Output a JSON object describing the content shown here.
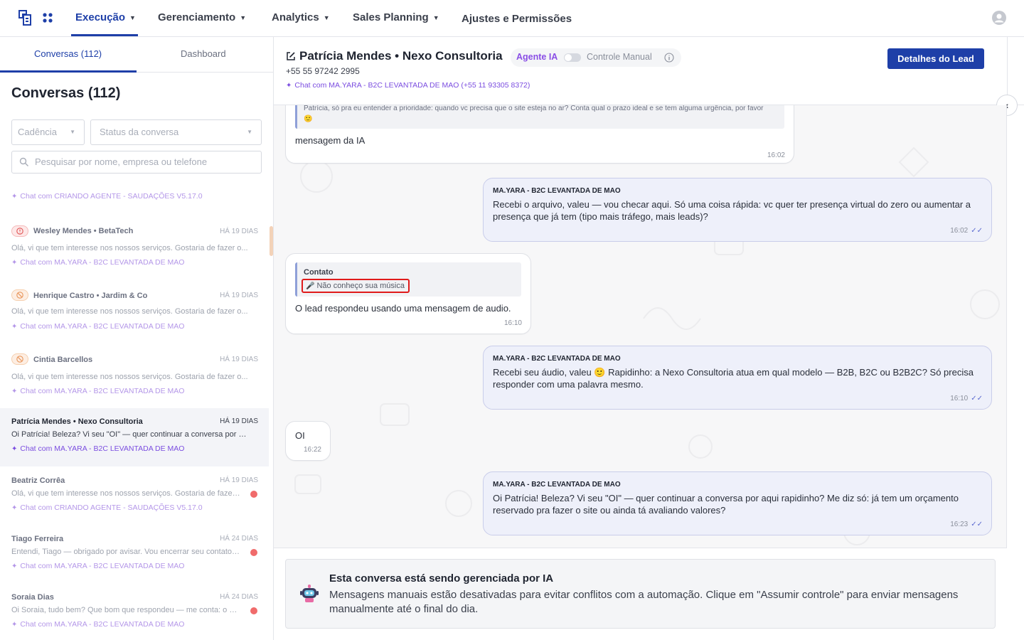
{
  "nav": {
    "items": [
      {
        "label": "Execução",
        "caret": true,
        "active": true
      },
      {
        "label": "Gerenciamento",
        "caret": true
      },
      {
        "label": "Analytics",
        "caret": true
      },
      {
        "label": "Sales Planning",
        "caret": true
      },
      {
        "label": "Ajustes e Permissões",
        "caret": false
      }
    ]
  },
  "sidebar": {
    "tabs": [
      {
        "label": "Conversas (112)",
        "active": true
      },
      {
        "label": "Dashboard"
      }
    ],
    "title": "Conversas (112)",
    "filters": {
      "cadence_placeholder": "Cadência",
      "status_placeholder": "Status da conversa"
    },
    "search_placeholder": "Pesquisar por nome, empresa ou telefone",
    "first_link": "Chat com CRIANDO AGENTE - SAUDAÇÕES V5.17.0",
    "conversations": [
      {
        "name": "Wesley Mendes • BetaTech",
        "time": "HÁ 19 DIAS",
        "preview": "Olá, vi que tem interesse nos nossos serviços. Gostaria de fazer o...",
        "link": "Chat com MA.YARA - B2C LEVANTADA DE MAO",
        "badge": "alert"
      },
      {
        "name": "Henrique Castro • Jardim & Co",
        "time": "HÁ 19 DIAS",
        "preview": "Olá, vi que tem interesse nos nossos serviços. Gostaria de fazer o...",
        "link": "Chat com MA.YARA - B2C LEVANTADA DE MAO",
        "badge": "blocked"
      },
      {
        "name": "Cintia Barcellos",
        "time": "HÁ 19 DIAS",
        "preview": "Olá, vi que tem interesse nos nossos serviços. Gostaria de fazer o...",
        "link": "Chat com MA.YARA - B2C LEVANTADA DE MAO",
        "badge": "blocked"
      },
      {
        "name": "Patrícia Mendes • Nexo Consultoria",
        "time": "HÁ 19 DIAS",
        "preview": "Oi Patrícia! Beleza? Vi seu \"OI\" — quer continuar a conversa por aqu...",
        "link": "Chat com MA.YARA - B2C LEVANTADA DE MAO",
        "selected": true
      },
      {
        "name": "Beatriz Corrêa",
        "time": "HÁ 19 DIAS",
        "preview": "Olá, vi que tem interesse nos nossos serviços. Gostaria de fazer ...",
        "link": "Chat com CRIANDO AGENTE - SAUDAÇÕES V5.17.0",
        "unread": true
      },
      {
        "name": "Tiago Ferreira",
        "time": "HÁ 24 DIAS",
        "preview": "Entendi, Tiago — obrigado por avisar. Vou encerrar seu contato ...",
        "link": "Chat com MA.YARA - B2C LEVANTADA DE MAO",
        "unread": true
      },
      {
        "name": "Soraia Dias",
        "time": "HÁ 24 DIAS",
        "preview": "Oi Soraia, tudo bem? Que bom que respondeu — me conta: o qu...",
        "link": "Chat com MA.YARA - B2C LEVANTADA DE MAO",
        "unread": true
      }
    ]
  },
  "chat": {
    "title": "Patrícia Mendes • Nexo Consultoria",
    "mode_ai": "Agente IA",
    "mode_manual": "Controle Manual",
    "phone": "+55 55 97242 2995",
    "link": "Chat com MA.YARA - B2C LEVANTADA DE MAO (+55 11 93305 8372)",
    "lead_button": "Detalhes do Lead",
    "messages": [
      {
        "dir": "in",
        "quote": "Patrícia, só pra eu entender a prioridade: quando vc precisa que o site esteja no ar? Conta qual o prazo ideal e se tem alguma urgência, por favor 🙂",
        "text": "mensagem da IA",
        "time": "16:02"
      },
      {
        "dir": "out",
        "sender": "MA.YARA - B2C LEVANTADA DE MAO",
        "text": "Recebi o arquivo, valeu — vou checar aqui. Só uma coisa rápida: vc quer ter presença virtual do zero ou aumentar a presença que já tem (tipo mais tráfego, mais leads)?",
        "time": "16:02"
      },
      {
        "dir": "in",
        "quote_title": "Contato",
        "audio_label": "Não conheço sua música",
        "text": "O lead respondeu usando uma mensagem de audio.",
        "time": "16:10"
      },
      {
        "dir": "out",
        "sender": "MA.YARA - B2C LEVANTADA DE MAO",
        "text": "Recebi seu áudio, valeu 🙂 Rapidinho: a Nexo Consultoria atua em qual modelo — B2B, B2C ou B2B2C? Só precisa responder com uma palavra mesmo.",
        "time": "16:10"
      },
      {
        "dir": "in",
        "text": "OI",
        "time": "16:22"
      },
      {
        "dir": "out",
        "sender": "MA.YARA - B2C LEVANTADA DE MAO",
        "text": "Oi Patrícia! Beleza? Vi seu \"OI\" — quer continuar a conversa por aqui rapidinho? Me diz só: já tem um orçamento reservado pra fazer o site ou ainda tá avaliando valores?",
        "time": "16:23"
      }
    ]
  },
  "notice": {
    "title": "Esta conversa está sendo gerenciada por IA",
    "text": "Mensagens manuais estão desativadas para evitar conflitos com a automação. Clique em \"Assumir controle\" para enviar mensagens manualmente até o final do dia."
  },
  "colors": {
    "primary": "#1e3fa8",
    "accent_purple": "#8a4ee6",
    "unread": "#f06b6b",
    "highlight": "#e01b1b"
  }
}
